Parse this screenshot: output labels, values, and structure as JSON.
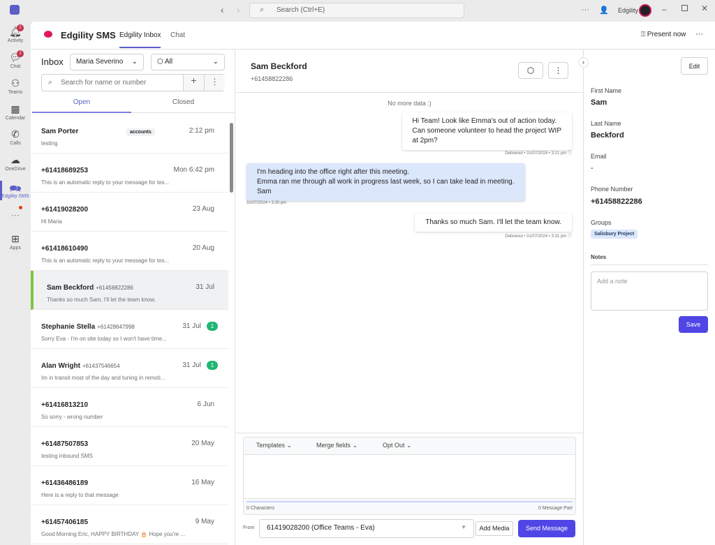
{
  "titlebar": {
    "search_placeholder": "Search (Ctrl+E)",
    "org": "Edgility"
  },
  "rail": [
    {
      "label": "Activity",
      "icon": "bell",
      "badge": "2"
    },
    {
      "label": "Chat",
      "icon": "chat",
      "badge": "2"
    },
    {
      "label": "Teams",
      "icon": "teams"
    },
    {
      "label": "Calendar",
      "icon": "calendar"
    },
    {
      "label": "Calls",
      "icon": "phone"
    },
    {
      "label": "OneDrive",
      "icon": "cloud"
    },
    {
      "label": "Edgility SMS",
      "icon": "sms"
    },
    {
      "label": "Apps",
      "icon": "plus"
    }
  ],
  "header": {
    "app_name": "Edgility SMS",
    "tabs": [
      "Edgility Inbox",
      "Chat"
    ],
    "present": "Present now"
  },
  "inbox": {
    "title": "Inbox",
    "user": "Maria Severino",
    "filter": "All",
    "search_placeholder": "Search for name or number",
    "tabs": [
      "Open",
      "Closed"
    ],
    "items": [
      {
        "name": "Sam Porter",
        "phone": "",
        "tag": "accounts",
        "time": "2:12 pm",
        "preview": "testing"
      },
      {
        "name": "+61418689253",
        "phone": "",
        "time": "Mon 6:42 pm",
        "preview": "This is an automatic reply to your message for tes..."
      },
      {
        "name": "+61419028200",
        "phone": "",
        "time": "23 Aug",
        "preview": "Hi Maria"
      },
      {
        "name": "+61418610490",
        "phone": "",
        "time": "20 Aug",
        "preview": "This is an automatic reply to your message for tes..."
      },
      {
        "name": "Sam Beckford",
        "phone": "+61458822286",
        "time": "31 Jul",
        "preview": "Thanks so much Sam. I'll let the team know.",
        "selected": true
      },
      {
        "name": "Stephanie Stella",
        "phone": "+61428647998",
        "time": "31 Jul",
        "preview": "Sorry Eva - I'm on site today so I won't have time...",
        "unread": "1"
      },
      {
        "name": "Alan Wright",
        "phone": "+61437546654",
        "time": "31 Jul",
        "preview": "Im in transit most of the day and tuning in remoti...",
        "unread": "1"
      },
      {
        "name": "+61416813210",
        "phone": "",
        "time": "6 Jun",
        "preview": "So sorry - wrong number"
      },
      {
        "name": "+61487507853",
        "phone": "",
        "time": "20 May",
        "preview": "testing inbound SMS"
      },
      {
        "name": "+61436486189",
        "phone": "",
        "time": "16 May",
        "preview": "Here is a reply to that message"
      },
      {
        "name": "+61457406185",
        "phone": "",
        "time": "9 May",
        "preview": "Good Morning Eric, HAPPY BIRTHDAY 🎂 Hope you're ..."
      }
    ]
  },
  "conversation": {
    "name": "Sam Beckford",
    "phone": "+61458822286",
    "no_more": "No more data :)",
    "messages": [
      {
        "dir": "out",
        "lines": [
          "Hi Team! Look like Emma's out of action today.",
          "Can someone volunteer to head the project WIP",
          "at 2pm?"
        ],
        "meta": "Delivered • 31/07/2024 • 3:21 pm"
      },
      {
        "dir": "in",
        "lines": [
          "I'm heading into the office right after this meeting.",
          "Emma ran me through all work in progress last week, so I can take lead in meeting.",
          "Sam"
        ],
        "meta": "31/07/2024 • 3:30 pm"
      },
      {
        "dir": "out",
        "lines": [
          "Thanks so much Sam. I'll let the team know."
        ],
        "meta": "Delivered • 31/07/2024 • 3:31 pm"
      }
    ]
  },
  "composer": {
    "menus": [
      "Templates",
      "Merge fields",
      "Opt Out"
    ],
    "chars": "0 Characters",
    "parts": "0 Message Part",
    "from_label": "From",
    "from_value": "61419028200 (Office Teams - Eva)",
    "add_media": "Add Media",
    "send": "Send Message"
  },
  "contact": {
    "edit": "Edit",
    "first_name_label": "First Name",
    "first_name": "Sam",
    "last_name_label": "Last Name",
    "last_name": "Beckford",
    "email_label": "Email",
    "email": "-",
    "phone_label": "Phone Number",
    "phone": "+61458822286",
    "groups_label": "Groups",
    "group": "Salisbury Project",
    "notes_label": "Notes",
    "notes_placeholder": "Add a note",
    "save": "Save"
  }
}
